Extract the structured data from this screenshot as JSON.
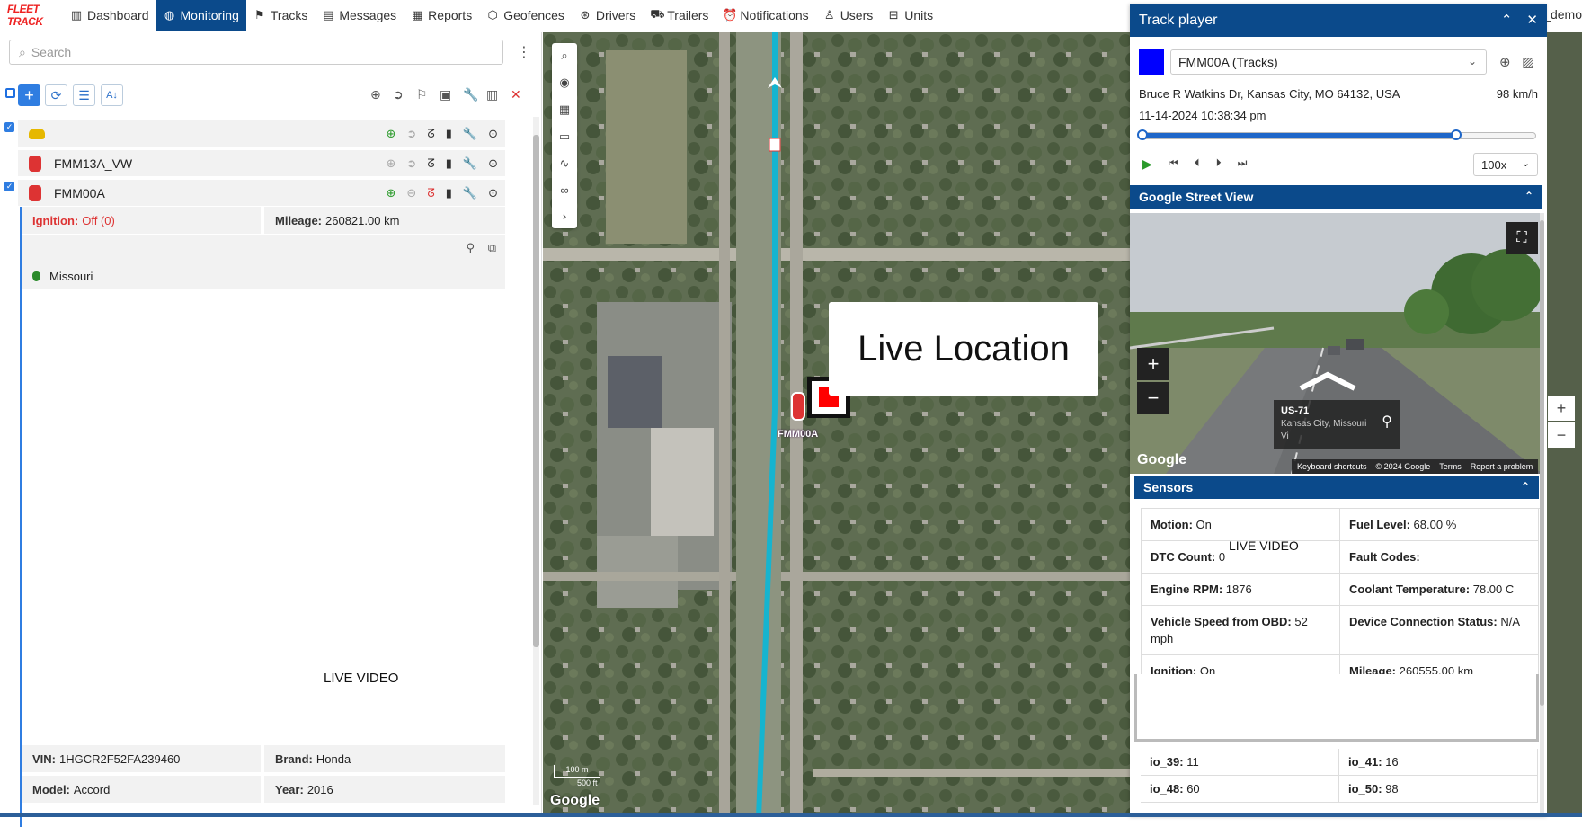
{
  "nav": {
    "logo_text": "FLEET TRACK",
    "items": [
      {
        "label": "Dashboard",
        "icon": "chart-bars-icon"
      },
      {
        "label": "Monitoring",
        "icon": "globe-icon",
        "active": true
      },
      {
        "label": "Tracks",
        "icon": "flag-icon"
      },
      {
        "label": "Messages",
        "icon": "document-icon"
      },
      {
        "label": "Reports",
        "icon": "report-icon"
      },
      {
        "label": "Geofences",
        "icon": "polygon-icon"
      },
      {
        "label": "Drivers",
        "icon": "steering-wheel-icon"
      },
      {
        "label": "Trailers",
        "icon": "trailer-icon"
      },
      {
        "label": "Notifications",
        "icon": "clock-alarm-icon"
      },
      {
        "label": "Users",
        "icon": "user-icon"
      },
      {
        "label": "Units",
        "icon": "bus-icon"
      }
    ],
    "user": "_demo"
  },
  "left": {
    "search_placeholder": "Search",
    "units": [
      {
        "name": "",
        "checked": true
      },
      {
        "name": "FMM13A_VW",
        "checked": false
      },
      {
        "name": "FMM00A",
        "checked": true
      }
    ],
    "details": {
      "ignition_label": "Ignition:",
      "ignition_value": "Off (0)",
      "mileage_label": "Mileage:",
      "mileage_value": "260821.00 km",
      "geofence": "Missouri"
    },
    "live_video": "LIVE VIDEO",
    "vin_label": "VIN:",
    "vin_value": "1HGCR2F52FA239460",
    "brand_label": "Brand:",
    "brand_value": "Honda",
    "model_label": "Model:",
    "model_value": "Accord",
    "year_label": "Year:",
    "year_value": "2016"
  },
  "map": {
    "live_location": "Live Location",
    "unit_label": "FMM00A",
    "google": "Google",
    "scale_m": "100 m",
    "scale_ft": "500 ft"
  },
  "track_player": {
    "title": "Track player",
    "unit_select": "FMM00A (Tracks)",
    "swatch_color": "#0000ff",
    "address": "Bruce R Watkins Dr, Kansas City, MO 64132, USA",
    "speed": "98 km/h",
    "datetime": "11-14-2024 10:38:34 pm",
    "progress": 0.8,
    "playback_speed": "100x"
  },
  "street_view": {
    "title": "Google Street View",
    "road": "US-71",
    "place": "Kansas City, Missouri",
    "view_link": "Vi",
    "footer": [
      "Keyboard shortcuts",
      "© 2024 Google",
      "Terms",
      "Report a problem"
    ],
    "google": "Google"
  },
  "sensors": {
    "title": "Sensors",
    "overlay": "LIVE VIDEO",
    "cells": [
      {
        "label": "Motion:",
        "value": "On"
      },
      {
        "label": "Fuel Level:",
        "value": "68.00 %"
      },
      {
        "label": "DTC Count:",
        "value": "0"
      },
      {
        "label": "Fault Codes:",
        "value": ""
      },
      {
        "label": "Engine RPM:",
        "value": "1876"
      },
      {
        "label": "Coolant Temperature:",
        "value": "78.00 C"
      },
      {
        "label": "Vehicle Speed from OBD:",
        "value": "52 mph"
      },
      {
        "label": "Device Connection Status:",
        "value": "N/A"
      },
      {
        "label": "Ignition:",
        "value": "On"
      },
      {
        "label": "Mileage:",
        "value": "260555.00 km"
      }
    ],
    "io": [
      {
        "label": "io_39:",
        "value": "11"
      },
      {
        "label": "io_41:",
        "value": "16"
      },
      {
        "label": "io_48:",
        "value": "60"
      },
      {
        "label": "io_50:",
        "value": "98"
      }
    ]
  }
}
